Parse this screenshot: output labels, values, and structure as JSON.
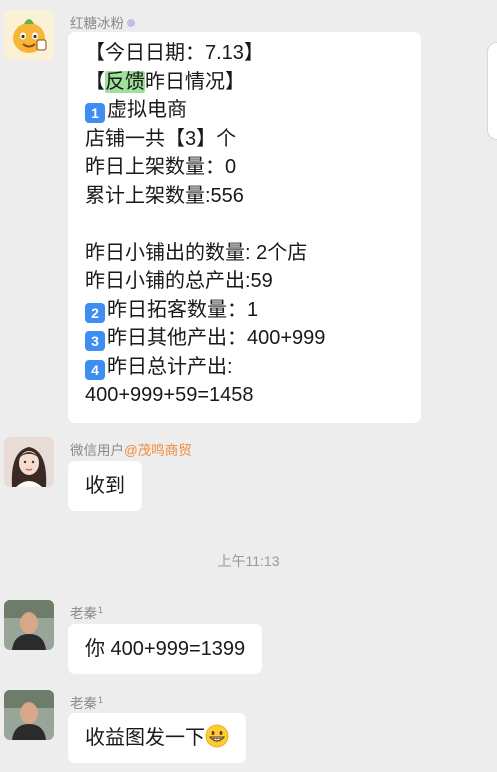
{
  "messages": {
    "m1": {
      "sender": "红糖冰粉",
      "lines": {
        "l1": "【今日日期：7.13】",
        "l2_pre": "【",
        "l2_hl": "反馈",
        "l2_post": "昨日情况】",
        "l3_num": "1",
        "l3": "虚拟电商",
        "l4": "店铺一共【3】个",
        "l5": "昨日上架数量：0",
        "l6": "累计上架数量:556",
        "l8": "昨日小铺出的数量: 2个店",
        "l9": "昨日小铺的总产出:59",
        "l10_num": "2",
        "l10": "昨日拓客数量：1",
        "l11_num": "3",
        "l11": "昨日其他产出：400+999",
        "l12_num": "4",
        "l12": "昨日总计产出:",
        "l13": "400+999+59=1458"
      }
    },
    "m2": {
      "sender": "微信用户",
      "sender_at": "@茂鸣商贸",
      "text": "收到"
    },
    "m3": {
      "sender": "老秦",
      "sender_sup": "1",
      "text": "你 400+999=1399"
    },
    "m4": {
      "sender": "老秦",
      "sender_sup": "1",
      "text": "收益图发一下"
    }
  },
  "time_divider": "上午11:13",
  "icons": {
    "avatar1": "cartoon-fruit-avatar",
    "avatar2": "woman-photo-avatar",
    "avatar3": "man-photo-avatar",
    "emoji": "grinning-face-emoji"
  }
}
